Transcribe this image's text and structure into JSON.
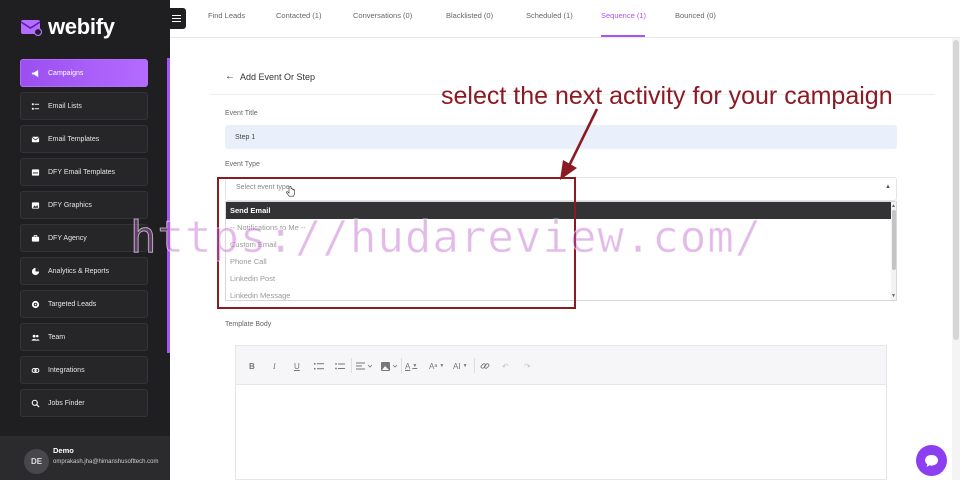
{
  "app": {
    "name": "webify",
    "colors": {
      "accent": "#a855f7",
      "sidebar": "#1f1f21",
      "annotation": "#8b1a22"
    }
  },
  "sidebar": {
    "items": [
      {
        "label": "Campaigns",
        "icon": "megaphone-icon",
        "active": true
      },
      {
        "label": "Email Lists",
        "icon": "list-icon"
      },
      {
        "label": "Email Templates",
        "icon": "envelope-icon"
      },
      {
        "label": "DFY Email Templates",
        "icon": "inbox-icon"
      },
      {
        "label": "DFY Graphics",
        "icon": "image-icon"
      },
      {
        "label": "DFY Agency",
        "icon": "briefcase-icon"
      },
      {
        "label": "Analytics & Reports",
        "icon": "pie-chart-icon"
      },
      {
        "label": "Targeted Leads",
        "icon": "target-icon"
      },
      {
        "label": "Team",
        "icon": "users-icon"
      },
      {
        "label": "Integrations",
        "icon": "link-icon"
      },
      {
        "label": "Jobs Finder",
        "icon": "search-icon"
      }
    ],
    "user": {
      "initials": "DE",
      "name": "Demo",
      "email": "omprakash.jha@himanshusofttech.com"
    }
  },
  "tabs": [
    {
      "label": "Find Leads"
    },
    {
      "label": "Contacted (1)"
    },
    {
      "label": "Conversations (0)"
    },
    {
      "label": "Blacklisted (0)"
    },
    {
      "label": "Scheduled (1)"
    },
    {
      "label": "Sequence (1)",
      "active": true
    },
    {
      "label": "Bounced (0)"
    }
  ],
  "form": {
    "back_title": "Add Event Or Step",
    "event_title_label": "Event Title",
    "event_title_value": "Step 1",
    "event_type_label": "Event Type",
    "event_type_placeholder": "Select event type",
    "event_type_options": [
      "Send Email",
      "-- Notifications to Me --",
      "Custom Email",
      "Phone Call",
      "Linkedin Post",
      "Linkedin Message"
    ],
    "selected_option_index": 0,
    "template_body_label": "Template Body"
  },
  "editor_toolbar": {
    "buttons": [
      "B",
      "I",
      "U",
      "A",
      "AI"
    ]
  },
  "annotation": {
    "text": "select the next activity for your campaign"
  },
  "watermark": {
    "text": "https://hudareview.com/"
  }
}
